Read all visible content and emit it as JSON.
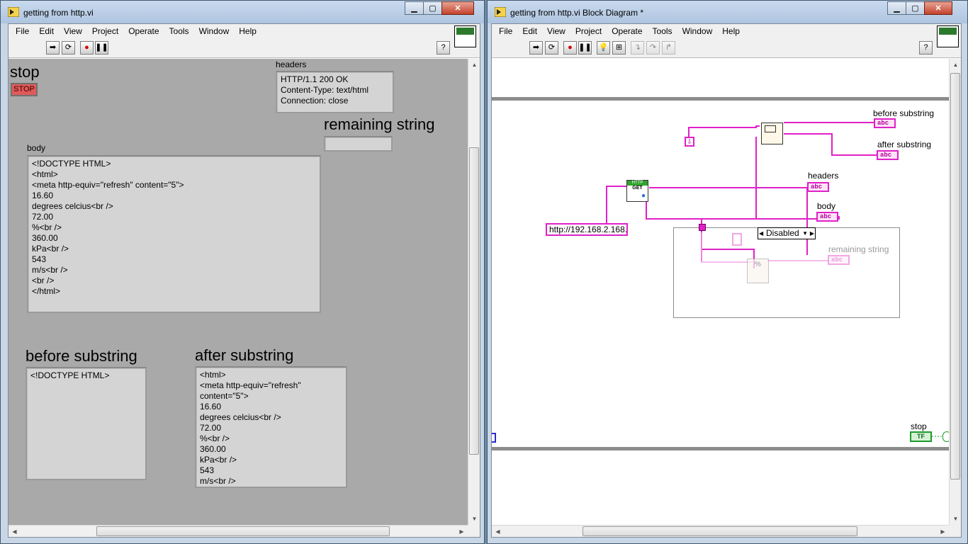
{
  "front_panel": {
    "window_title": "getting from http.vi",
    "menu": [
      "File",
      "Edit",
      "View",
      "Project",
      "Operate",
      "Tools",
      "Window",
      "Help"
    ],
    "stop_label": "stop",
    "stop_button_text": "STOP",
    "headers_label": "headers",
    "headers_value": "HTTP/1.1 200 OK\nContent-Type: text/html\nConnection: close",
    "remaining_label": "remaining string",
    "remaining_value": "",
    "body_label": "body",
    "body_value": "<!DOCTYPE HTML>\n<html>\n<meta http-equiv=\"refresh\" content=\"5\">\n16.60\ndegrees celcius<br />\n72.00\n%<br />\n360.00\nkPa<br />\n543\nm/s<br />\n<br />\n</html>",
    "before_label": "before substring",
    "before_value": "<!DOCTYPE HTML>",
    "after_label": "after substring",
    "after_value": "<html>\n<meta http-equiv=\"refresh\"\ncontent=\"5\">\n16.60\ndegrees celcius<br />\n72.00\n%<br />\n360.00\nkPa<br />\n543\nm/s<br />"
  },
  "block_diagram": {
    "window_title": "getting from http.vi Block Diagram *",
    "menu": [
      "File",
      "Edit",
      "View",
      "Project",
      "Operate",
      "Tools",
      "Window",
      "Help"
    ],
    "url_constant": "http://192.168.2.168.",
    "http_node_top": "HTTP",
    "http_node_label": "GET",
    "case_selector": "Disabled",
    "labels": {
      "before": "before substring",
      "after": "after substring",
      "headers": "headers",
      "body": "body",
      "remaining": "remaining string",
      "stop": "stop"
    },
    "string_terminal": "abc",
    "bool_terminal": "TF"
  },
  "icons": {
    "run": "run-arrow-icon",
    "run_continuous": "run-continuously-icon",
    "abort": "abort-icon",
    "pause": "pause-icon",
    "highlight": "highlight-execution-icon",
    "retain": "retain-wire-values-icon",
    "step_into": "step-into-icon",
    "step_over": "step-over-icon",
    "step_out": "step-out-icon",
    "help": "help-icon"
  },
  "colors": {
    "string_wire": "#e021c7",
    "panel_bg": "#a9a9a9",
    "stop_red": "#e05a5a",
    "boolean_green": "#1e9b2c"
  }
}
